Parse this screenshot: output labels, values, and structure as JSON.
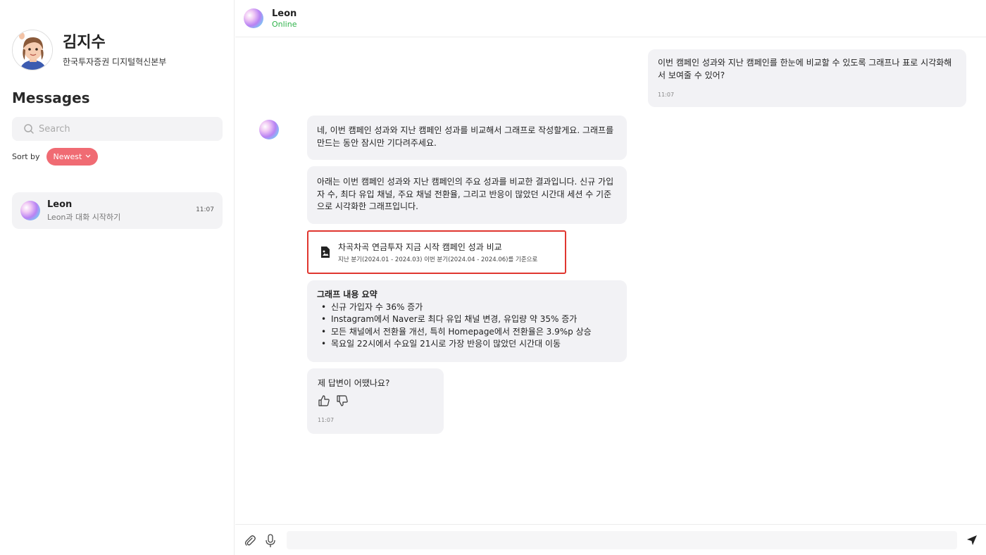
{
  "profile": {
    "name": "김지수",
    "org": "한국투자증권 디지털혁신본부"
  },
  "sidebar": {
    "title": "Messages",
    "search_placeholder": "Search",
    "sort_label": "Sort by",
    "sort_value": "Newest",
    "conversations": [
      {
        "name": "Leon",
        "preview": "Leon과 대화 시작하기",
        "time": "11:07"
      }
    ]
  },
  "header": {
    "name": "Leon",
    "status": "Online"
  },
  "messages": {
    "user": {
      "text": "이번 캠페인 성과와 지난 캠페인를 한눈에 비교할 수 있도록 그래프나 표로 시각화해서 보여줄 수 있어?",
      "time": "11:07"
    },
    "bot1": "네, 이번 캠페인 성과와 지난 캠페인 성과를 비교해서 그래프로 작성할게요. 그래프를 만드는 동안 잠시만 기다려주세요.",
    "bot2": "아래는 이번 캠페인 성과와 지난 캠페인의 주요 성과를 비교한 결과입니다. 신규 가입자 수, 최다 유입 채널, 주요 채널 전환율, 그리고 반응이 많았던 시간대 세션 수 기준으로 시각화한 그래프입니다.",
    "attachment": {
      "title": "차곡차곡 연금투자 지금 시작 캠페인 성과 비교",
      "subtitle": "지난 분기(2024.01 - 2024.03) 이번 분기(2024.04 - 2024.06)를 기준으로"
    },
    "summary": {
      "heading": "그래프 내용 요약",
      "items": [
        "신규 가입자 수 36% 증가",
        "Instagram에서 Naver로 최다 유입 채널 변경, 유입량 약 35% 증가",
        "모든 채널에서 전환율 개선, 특히 Homepage에서 전환율은 3.9%p 상승",
        "목요일 22시에서 수요일 21시로 가장 반응이 많았던 시간대 이동"
      ]
    },
    "feedback": {
      "question": "제 답변이 어땠나요?",
      "time": "11:07"
    }
  },
  "colors": {
    "accent": "#f06b73",
    "online": "#2fb34a",
    "highlight_border": "#e0362f",
    "bubble": "#f2f2f5"
  }
}
